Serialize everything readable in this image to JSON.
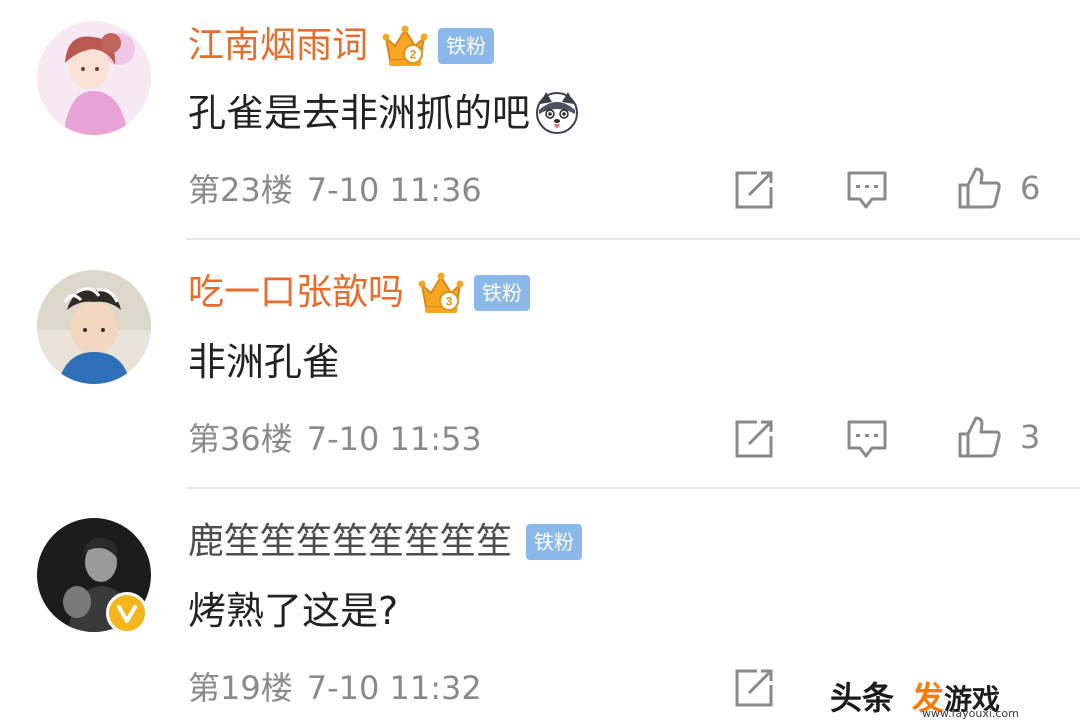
{
  "comments": [
    {
      "username": "江南烟雨词",
      "crown_level": "2",
      "fan_badge": "铁粉",
      "text": "孔雀是去非洲抓的吧",
      "emoji": "husky-dog-emoji",
      "floor": "第23楼",
      "time": "7-10 11:36",
      "likes": "6"
    },
    {
      "username": "吃一口张歆吗",
      "crown_level": "3",
      "fan_badge": "铁粉",
      "text": "非洲孔雀",
      "floor": "第36楼",
      "time": "7-10 11:53",
      "likes": "3"
    },
    {
      "username": "鹿笙笙笙笙笙笙笙笙",
      "fan_badge": "铁粉",
      "text": "烤熟了这是?",
      "verified": true,
      "floor": "第19楼",
      "time": "7-10 11:32"
    }
  ],
  "watermark": {
    "prefix": "头条",
    "brand_highlight": "发",
    "brand_rest": "游戏",
    "url": "www.fayouxi.com"
  },
  "colors": {
    "username": "#e86c2c",
    "fan_badge": "#8ab8ea",
    "meta": "#8a8a8a",
    "verified_badge": "#f5b51d",
    "crown": "#f5a623"
  }
}
